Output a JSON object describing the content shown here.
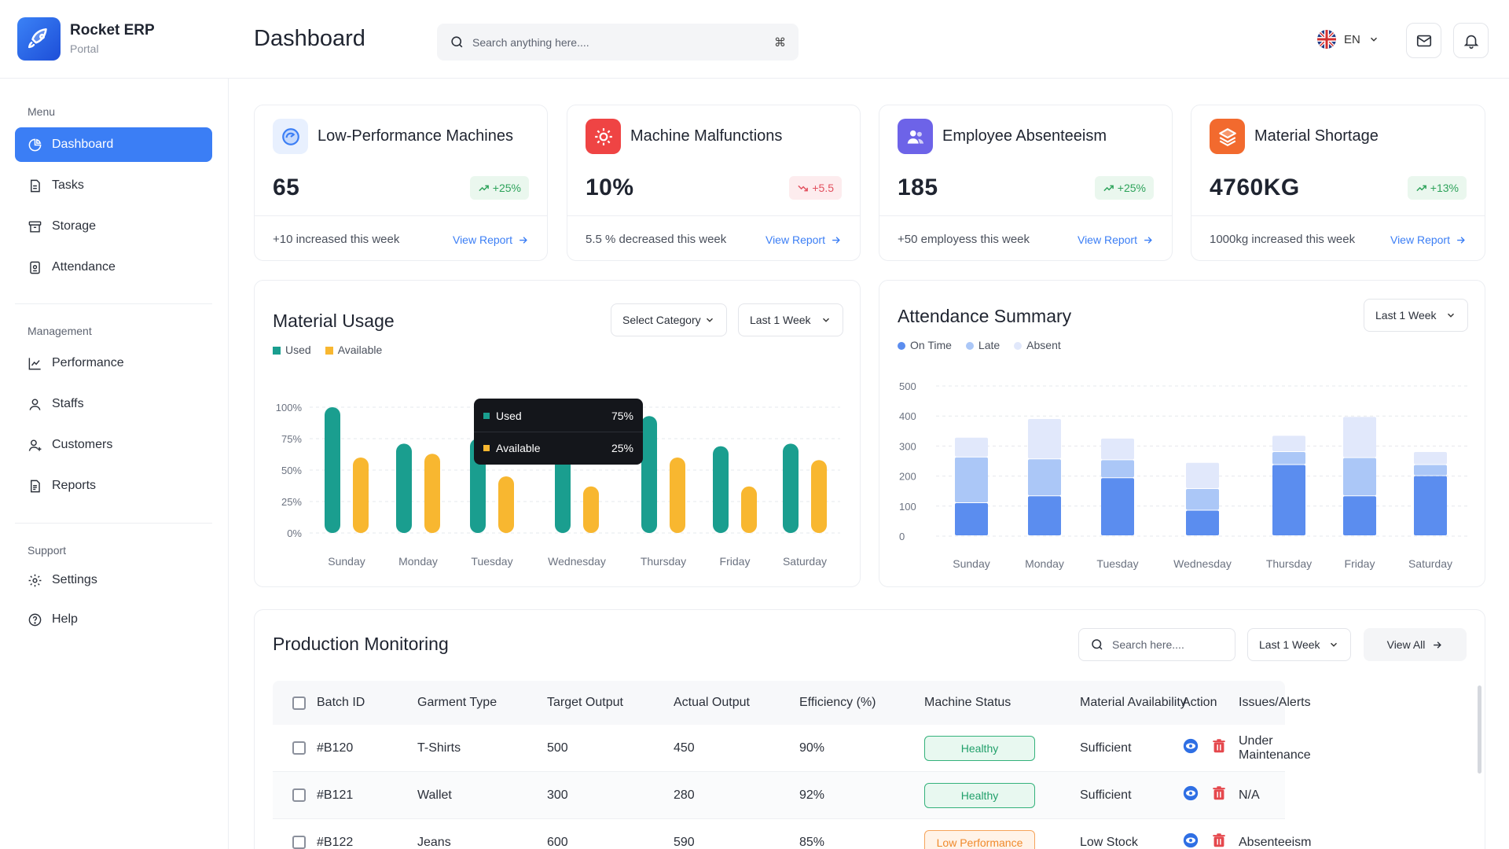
{
  "app": {
    "name": "Rocket ERP",
    "subtitle": "Portal"
  },
  "header": {
    "title": "Dashboard",
    "search_placeholder": "Search anything here....",
    "shortcut": "⌘",
    "language": "EN"
  },
  "sidebar": {
    "sections": [
      {
        "title": "Menu",
        "items": [
          {
            "label": "Dashboard",
            "icon": "pie-chart-icon",
            "active": true
          },
          {
            "label": "Tasks",
            "icon": "document-icon"
          },
          {
            "label": "Storage",
            "icon": "archive-icon"
          },
          {
            "label": "Attendance",
            "icon": "badge-icon"
          }
        ]
      },
      {
        "title": "Management",
        "items": [
          {
            "label": "Performance",
            "icon": "trend-icon"
          },
          {
            "label": "Staffs",
            "icon": "user-icon"
          },
          {
            "label": "Customers",
            "icon": "user-plus-icon"
          },
          {
            "label": "Reports",
            "icon": "report-icon"
          }
        ]
      },
      {
        "title": "Support",
        "items": [
          {
            "label": "Settings",
            "icon": "gear-icon"
          },
          {
            "label": "Help",
            "icon": "help-icon"
          }
        ]
      }
    ]
  },
  "stats": [
    {
      "title": "Low-Performance Machines",
      "value": "65",
      "change": "+25%",
      "trend": "up",
      "note": "+10 increased this week",
      "link": "View Report",
      "icon_color": "#3b7ef5"
    },
    {
      "title": "Machine Malfunctions",
      "value": "10%",
      "change": "+5.5",
      "trend": "down",
      "note": "5.5 % decreased this week",
      "link": "View Report",
      "icon_color": "#ef4444"
    },
    {
      "title": "Employee Absenteeism",
      "value": "185",
      "change": "+25%",
      "trend": "up",
      "note": "+50 employess this week",
      "link": "View Report",
      "icon_color": "#6d63e8"
    },
    {
      "title": "Material Shortage",
      "value": "4760KG",
      "change": "+13%",
      "trend": "up",
      "note": "1000kg increased this week",
      "link": "View Report",
      "icon_color": "#f26a2e"
    }
  ],
  "material_usage": {
    "title": "Material Usage",
    "category_select": "Select Category",
    "range_select": "Last 1 Week",
    "tooltip": {
      "used_label": "Used",
      "used_value": "75%",
      "available_label": "Available",
      "available_value": "25%"
    }
  },
  "attendance_summary": {
    "title": "Attendance Summary",
    "range_select": "Last 1 Week"
  },
  "chart_data": [
    {
      "type": "bar",
      "title": "Material Usage",
      "categories": [
        "Sunday",
        "Monday",
        "Tuesday",
        "Wednesday",
        "Thursday",
        "Friday",
        "Saturday"
      ],
      "y_ticks": [
        "100%",
        "75%",
        "50%",
        "25%",
        "0%"
      ],
      "ylim": [
        0,
        100
      ],
      "series": [
        {
          "name": "Used",
          "color": "#1a9e8f",
          "values": [
            100,
            71,
            75,
            66,
            93,
            69,
            71
          ]
        },
        {
          "name": "Available",
          "color": "#f8b730",
          "values": [
            60,
            63,
            45,
            37,
            60,
            37,
            58
          ]
        }
      ]
    },
    {
      "type": "bar",
      "stacked": true,
      "title": "Attendance Summary",
      "categories": [
        "Sunday",
        "Monday",
        "Tuesday",
        "Wednesday",
        "Thursday",
        "Friday",
        "Saturday"
      ],
      "y_ticks": [
        "500",
        "400",
        "300",
        "200",
        "100",
        "0"
      ],
      "ylim": [
        0,
        500
      ],
      "series": [
        {
          "name": "On Time",
          "color": "#5b8def",
          "values": [
            110,
            133,
            193,
            85,
            237,
            133,
            200
          ]
        },
        {
          "name": "Late",
          "color": "#abc7f7",
          "values": [
            152,
            123,
            60,
            72,
            43,
            127,
            37
          ]
        },
        {
          "name": "Absent",
          "color": "#e1e8fb",
          "values": [
            66,
            134,
            72,
            87,
            54,
            137,
            43
          ]
        }
      ]
    }
  ],
  "production": {
    "title": "Production Monitoring",
    "search_placeholder": "Search here....",
    "range_select": "Last 1 Week",
    "view_all": "View All",
    "columns": [
      "Batch ID",
      "Garment Type",
      "Target Output",
      "Actual Output",
      "Efficiency (%)",
      "Machine Status",
      "Material Availability",
      "Issues/Alerts",
      "Action"
    ],
    "rows": [
      {
        "batch": "#B120",
        "garment": "T-Shirts",
        "target": "500",
        "actual": "450",
        "efficiency": "90%",
        "status": "Healthy",
        "status_kind": "healthy",
        "material": "Sufficient",
        "issues": "Under Maintenance"
      },
      {
        "batch": "#B121",
        "garment": "Wallet",
        "target": "300",
        "actual": "280",
        "efficiency": "92%",
        "status": "Healthy",
        "status_kind": "healthy",
        "material": "Sufficient",
        "issues": "N/A"
      },
      {
        "batch": "#B122",
        "garment": "Jeans",
        "target": "600",
        "actual": "590",
        "efficiency": "85%",
        "status": "Low Performance",
        "status_kind": "low",
        "material": "Low Stock",
        "issues": "Absenteeism"
      }
    ]
  }
}
